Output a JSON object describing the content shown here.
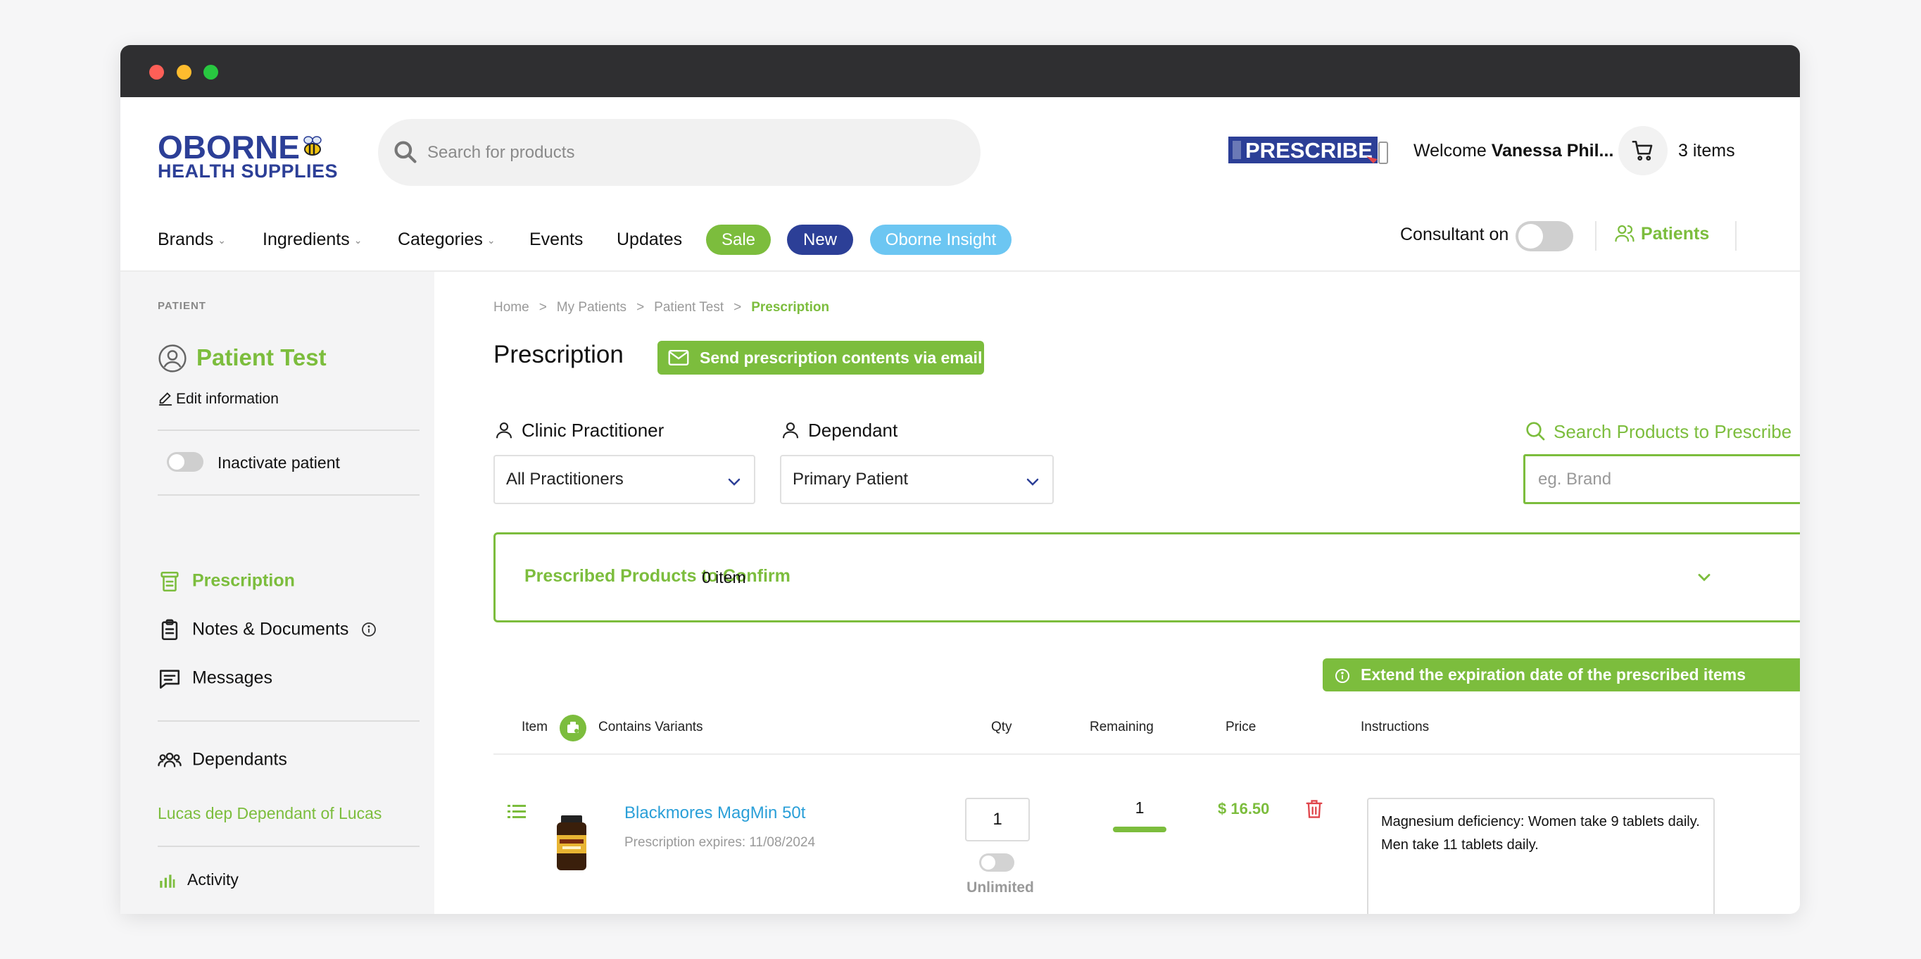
{
  "header": {
    "logo_main": "OBORNE",
    "logo_sub": "HEALTH SUPPLIES",
    "search_placeholder": "Search for products",
    "prescribe_logo": "PRESCRIBE",
    "welcome_prefix": "Welcome ",
    "welcome_name": "Vanessa Phil...",
    "cart_count": "3 items"
  },
  "nav": {
    "items": [
      "Brands",
      "Ingredients",
      "Categories",
      "Events",
      "Updates"
    ],
    "pills": {
      "sale": "Sale",
      "new": "New",
      "insight": "Oborne Insight"
    },
    "consultant_label": "Consultant on",
    "patients_label": "Patients"
  },
  "sidebar": {
    "section_label": "PATIENT",
    "patient_name": "Patient Test",
    "edit_info": "Edit information",
    "inactivate": "Inactivate patient",
    "menu": {
      "prescription": "Prescription",
      "notes": "Notes & Documents",
      "messages": "Messages",
      "dependants": "Dependants",
      "activity": "Activity"
    },
    "dependant_link": "Lucas dep Dependant of Lucas"
  },
  "main": {
    "breadcrumb": [
      "Home",
      "My Patients",
      "Patient Test",
      "Prescription"
    ],
    "title": "Prescription",
    "email_button": "Send prescription contents via email",
    "practitioner_label": "Clinic Practitioner",
    "practitioner_value": "All Practitioners",
    "dependant_label": "Dependant",
    "dependant_value": "Primary Patient",
    "search_label": "Search Products to Prescribe",
    "search_placeholder": "eg. Brand",
    "confirm_title": "Prescribed Products to Confirm",
    "confirm_count": "0 item",
    "extend_button": "Extend the expiration date of the prescribed items",
    "table_headers": {
      "item": "Item",
      "variants": "Contains Variants",
      "qty": "Qty",
      "remaining": "Remaining",
      "price": "Price",
      "instructions": "Instructions"
    },
    "row": {
      "product_name": "Blackmores MagMin 50t",
      "expires": "Prescription expires: 11/08/2024",
      "qty": "1",
      "unlimited": "Unlimited",
      "remaining": "1",
      "remaining_fraction": 1.0,
      "price": "$ 16.50",
      "instructions": "Magnesium deficiency: Women take 9 tablets daily. Men take 11 tablets daily."
    }
  },
  "colors": {
    "brand_blue": "#2c3f97",
    "accent_green": "#7cbd3d",
    "link_blue": "#2a9fd8",
    "insight_blue": "#6cc6f2",
    "danger_red": "#e0454b"
  }
}
